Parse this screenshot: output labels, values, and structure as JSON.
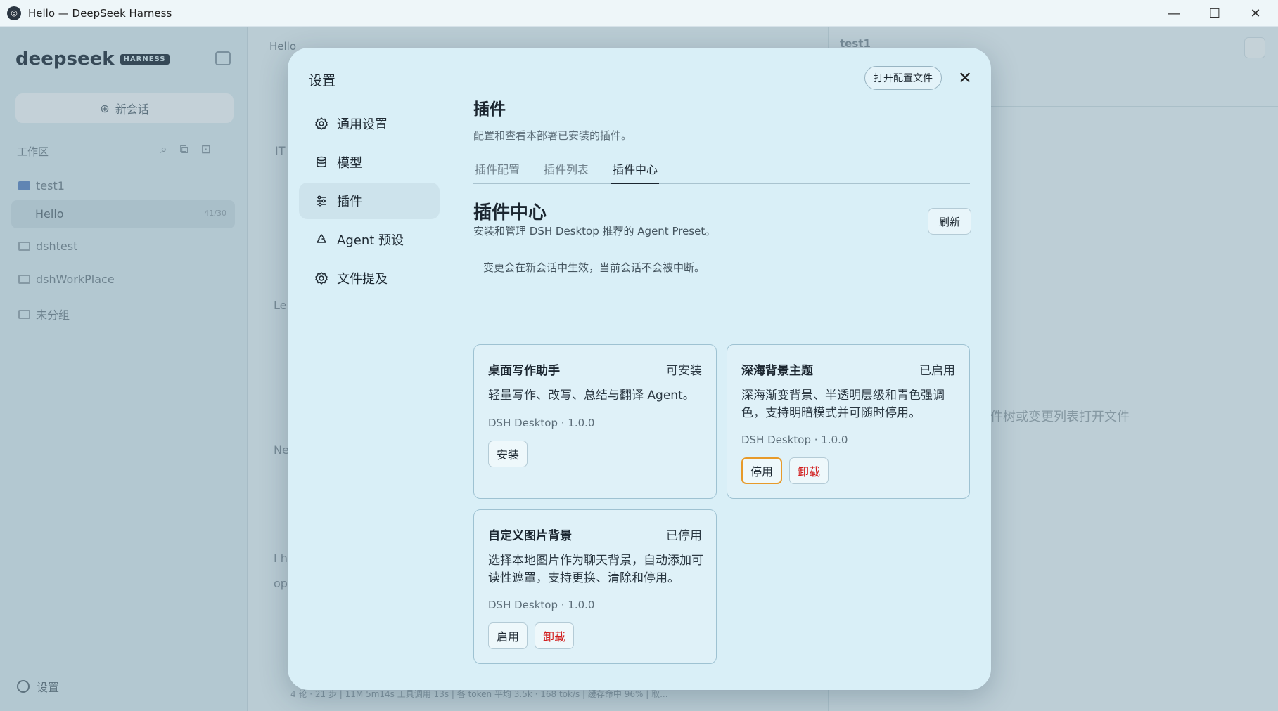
{
  "window": {
    "title": "Hello — DeepSeek Harness",
    "minimize": "—",
    "maximize": "☐",
    "close": "✕"
  },
  "background": {
    "sidebar": {
      "logo": "deepseek",
      "logo_badge": "HARNESS",
      "new_chat": "新会话",
      "workspace_label": "工作区",
      "items": [
        {
          "label": "test1"
        },
        {
          "label": "Hello",
          "count": "41/30"
        },
        {
          "label": "dshtest"
        },
        {
          "label": "dshWorkPlace"
        },
        {
          "label": "未分组"
        }
      ],
      "settings": "设置"
    },
    "center": {
      "tab": "Hello",
      "frag1": "IT",
      "frag2": "Le",
      "frag3": "Ne",
      "frag4": "I h",
      "frag5": "op",
      "status": "4 轮 · 21 步 | 11M 5m14s 工具调用 13s | 各 token 平均 3.5k · 168 tok/s | 缓存命中 96% | 取..."
    },
    "right": {
      "title": "test1",
      "hint": "件树或变更列表打开文件"
    }
  },
  "modal": {
    "title": "设置",
    "open_config": "打开配置文件",
    "close": "✕",
    "nav": [
      {
        "label": "通用设置",
        "icon": "gear-icon"
      },
      {
        "label": "模型",
        "icon": "database-icon"
      },
      {
        "label": "插件",
        "icon": "sliders-icon",
        "active": true
      },
      {
        "label": "Agent 预设",
        "icon": "recycle-icon"
      },
      {
        "label": "文件提及",
        "icon": "gear-icon"
      }
    ],
    "header": {
      "title": "插件",
      "subtitle": "配置和查看本部署已安装的插件。"
    },
    "tabs": [
      {
        "label": "插件配置"
      },
      {
        "label": "插件列表"
      },
      {
        "label": "插件中心",
        "active": true
      }
    ],
    "center": {
      "title": "插件中心",
      "subtitle": "安装和管理 DSH Desktop 推荐的 Agent Preset。",
      "refresh": "刷新",
      "notice": "变更会在新会话中生效，当前会话不会被中断。"
    },
    "plugins": [
      {
        "name": "桌面写作助手",
        "status": "可安装",
        "description": "轻量写作、改写、总结与翻译 Agent。",
        "meta": "DSH Desktop · 1.0.0",
        "actions": [
          "安装"
        ]
      },
      {
        "name": "深海背景主题",
        "status": "已启用",
        "description": "深海渐变背景、半透明层级和青色强调色，支持明暗模式并可随时停用。",
        "meta": "DSH Desktop · 1.0.0",
        "actions": [
          "停用",
          "卸载"
        ]
      },
      {
        "name": "自定义图片背景",
        "status": "已停用",
        "description": "选择本地图片作为聊天背景，自动添加可读性遮罩，支持更换、清除和停用。",
        "meta": "DSH Desktop · 1.0.0",
        "actions": [
          "启用",
          "卸载"
        ]
      }
    ]
  }
}
